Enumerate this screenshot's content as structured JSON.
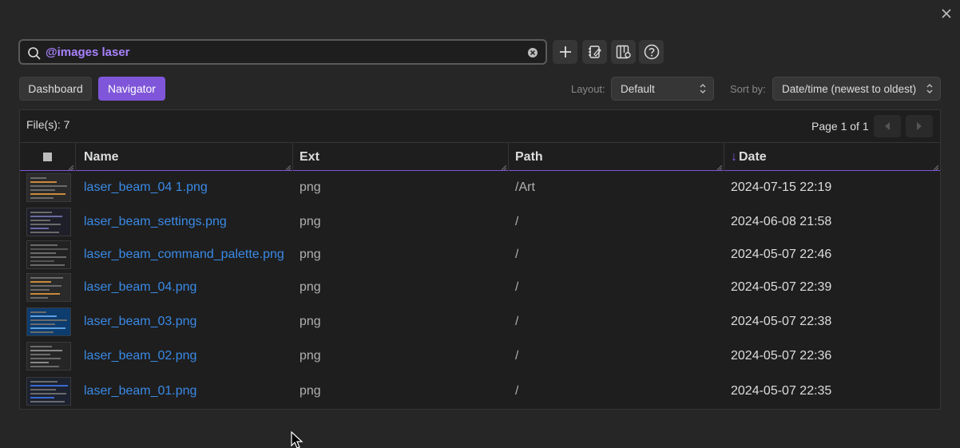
{
  "search": {
    "value": "@images laser",
    "placeholder": ""
  },
  "toolbar": {
    "add_icon": "plus-icon",
    "notebook_icon": "notebook-edit-icon",
    "layout_settings_icon": "layout-settings-icon",
    "help_icon": "help-icon"
  },
  "views": {
    "dashboard_label": "Dashboard",
    "navigator_label": "Navigator"
  },
  "layout": {
    "label": "Layout:",
    "value": "Default"
  },
  "sort": {
    "label": "Sort by:",
    "value": "Date/time (newest to oldest)"
  },
  "summary": {
    "files_label": "File(s): 7",
    "page_label": "Page 1 of 1"
  },
  "table": {
    "columns": {
      "name": "Name",
      "ext": "Ext",
      "path": "Path",
      "date": "Date",
      "sort_arrow": "↓"
    },
    "rows": [
      {
        "name": "laser_beam_04 1.png",
        "ext": "png",
        "path": "/Art",
        "date": "2024-07-15 22:19"
      },
      {
        "name": "laser_beam_settings.png",
        "ext": "png",
        "path": "/",
        "date": "2024-06-08 21:58"
      },
      {
        "name": "laser_beam_command_palette.png",
        "ext": "png",
        "path": "/",
        "date": "2024-05-07 22:46"
      },
      {
        "name": "laser_beam_04.png",
        "ext": "png",
        "path": "/",
        "date": "2024-05-07 22:39"
      },
      {
        "name": "laser_beam_03.png",
        "ext": "png",
        "path": "/",
        "date": "2024-05-07 22:38"
      },
      {
        "name": "laser_beam_02.png",
        "ext": "png",
        "path": "/",
        "date": "2024-05-07 22:36"
      },
      {
        "name": "laser_beam_01.png",
        "ext": "png",
        "path": "/",
        "date": "2024-05-07 22:35"
      }
    ]
  },
  "colors": {
    "accent": "#7f56d9",
    "link": "#3a8ae6",
    "background": "#262626"
  }
}
